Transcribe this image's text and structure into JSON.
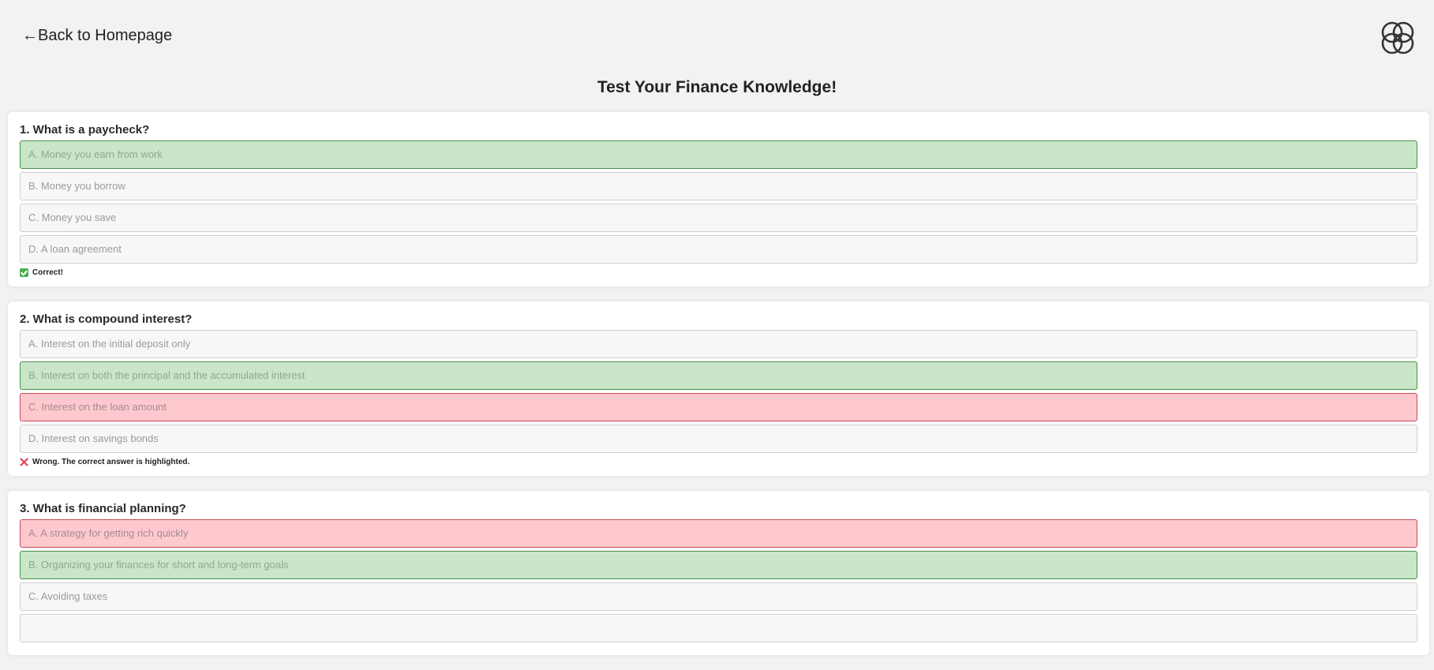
{
  "nav": {
    "back_label": "←Back to Homepage",
    "logo_icon": "interlocking-circles-logo"
  },
  "page": {
    "title": "Test Your Finance Knowledge!"
  },
  "colors": {
    "correct_bg": "#c9e6c9",
    "correct_border": "#4a8f4a",
    "wrong_bg": "#fdc9cf",
    "wrong_border": "#c64a55",
    "page_bg": "#f2f2f2"
  },
  "questions": [
    {
      "text": "1. What is a paycheck?",
      "options": [
        {
          "label": "A. Money you earn from work",
          "state": "correct"
        },
        {
          "label": "B. Money you borrow",
          "state": "neutral"
        },
        {
          "label": "C. Money you save",
          "state": "neutral"
        },
        {
          "label": "D. A loan agreement",
          "state": "neutral"
        }
      ],
      "feedback": {
        "icon": "check-icon",
        "text": "Correct!"
      }
    },
    {
      "text": "2. What is compound interest?",
      "options": [
        {
          "label": "A. Interest on the initial deposit only",
          "state": "neutral"
        },
        {
          "label": "B. Interest on both the principal and the accumulated interest",
          "state": "correct"
        },
        {
          "label": "C. Interest on the loan amount",
          "state": "wrong"
        },
        {
          "label": "D. Interest on savings bonds",
          "state": "neutral"
        }
      ],
      "feedback": {
        "icon": "cross-icon",
        "text": "Wrong. The correct answer is highlighted."
      }
    },
    {
      "text": "3. What is financial planning?",
      "options": [
        {
          "label": "A. A strategy for getting rich quickly",
          "state": "wrong"
        },
        {
          "label": "B. Organizing your finances for short and long-term goals",
          "state": "correct"
        },
        {
          "label": "C. Avoiding taxes",
          "state": "neutral"
        },
        {
          "label": "",
          "state": "neutral"
        }
      ]
    }
  ]
}
